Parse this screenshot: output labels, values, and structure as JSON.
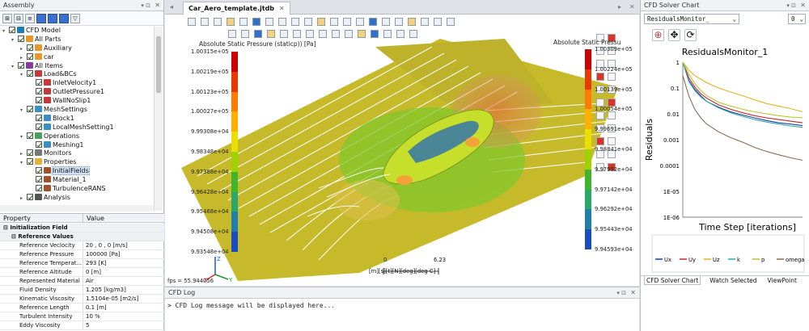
{
  "assembly": {
    "title": "Assembly",
    "tree": [
      {
        "label": "CFD Model",
        "depth": 0,
        "icon": "#1f7ab8",
        "open": true
      },
      {
        "label": "All Parts",
        "depth": 1,
        "icon": "#e8972a",
        "open": true
      },
      {
        "label": "Auxiliary",
        "depth": 2,
        "icon": "#e8972a",
        "open": false
      },
      {
        "label": "car",
        "depth": 2,
        "icon": "#e8972a",
        "open": false
      },
      {
        "label": "All Items",
        "depth": 1,
        "icon": "#8a3b99",
        "open": true
      },
      {
        "label": "Load&BCs",
        "depth": 2,
        "icon": "#c43a3a",
        "open": true
      },
      {
        "label": "InletVelocity1",
        "depth": 3,
        "icon": "#c43a3a"
      },
      {
        "label": "OutletPressure1",
        "depth": 3,
        "icon": "#c43a3a"
      },
      {
        "label": "WallNoSlip1",
        "depth": 3,
        "icon": "#c43a3a"
      },
      {
        "label": "MeshSettings",
        "depth": 2,
        "icon": "#3a8fc4",
        "open": true
      },
      {
        "label": "Block1",
        "depth": 3,
        "icon": "#3a8fc4"
      },
      {
        "label": "LocalMeshSetting1",
        "depth": 3,
        "icon": "#3a8fc4"
      },
      {
        "label": "Operations",
        "depth": 2,
        "icon": "#4aa05a",
        "open": true
      },
      {
        "label": "Meshing1",
        "depth": 3,
        "icon": "#3a8fc4"
      },
      {
        "label": "Monitors",
        "depth": 2,
        "icon": "#777777",
        "open": false
      },
      {
        "label": "Properties",
        "depth": 2,
        "icon": "#e0b23a",
        "open": true
      },
      {
        "label": "InitialFields",
        "depth": 3,
        "icon": "#a0522d",
        "selected": true
      },
      {
        "label": "Material_1",
        "depth": 3,
        "icon": "#a0522d"
      },
      {
        "label": "TurbulenceRANS",
        "depth": 3,
        "icon": "#a0522d"
      },
      {
        "label": "Analysis",
        "depth": 2,
        "icon": "#555555",
        "open": false
      }
    ]
  },
  "properties": {
    "col1": "Property",
    "col2": "Value",
    "group": "Initialization Field",
    "subgroup": "Reference Values",
    "rows": [
      {
        "k": "Reference Veclocity",
        "v": "20 , 0 , 0 [m/s]"
      },
      {
        "k": "Reference Pressure",
        "v": "100000 [Pa]"
      },
      {
        "k": "Reference Temperat...",
        "v": "293 [K]"
      },
      {
        "k": "Reference Altitude",
        "v": "0 [m]"
      },
      {
        "k": "Represented Material",
        "v": "Air"
      },
      {
        "k": "Fluid Density",
        "v": "1.205 [kg/m3]"
      },
      {
        "k": "Kinematic Viscosity",
        "v": "1.5104e-05 [m2/s]"
      },
      {
        "k": "Reference Length",
        "v": "0.1 [m]"
      },
      {
        "k": "Turbulent Intensity",
        "v": "10 %"
      },
      {
        "k": "Eddy Viscosity",
        "v": "5"
      }
    ]
  },
  "document": {
    "tab": "Car_Aero_template.jtdb",
    "legend_left": {
      "title": "Absolute Static Pressure (staticp)) [Pa]",
      "ticks": [
        "1.00315e+05",
        "1.00219e+05",
        "1.00123e+05",
        "1.00027e+05",
        "9.99308e+04",
        "9.98348e+04",
        "9.97388e+04",
        "9.96428e+04",
        "9.95468e+04",
        "9.94508e+04",
        "9.93548e+04"
      ]
    },
    "legend_right": {
      "title": "Absolute Static Pressu",
      "ticks": [
        "1.00309e+05",
        "1.00224e+05",
        "1.00139e+05",
        "1.00054e+05",
        "9.99691e+04",
        "9.98841e+04",
        "9.97992e+04",
        "9.97142e+04",
        "9.96292e+04",
        "9.95443e+04",
        "9.94593e+04"
      ]
    },
    "fps": "fps = 55.944056",
    "scale": {
      "zero": "0",
      "max": "6.23",
      "units": "[m][s][t][N][deg][deg C]"
    },
    "axes": {
      "x": "X",
      "y": "Y",
      "z": "Z"
    },
    "colormap": [
      "#cc0000",
      "#e63a00",
      "#ff7a00",
      "#ffb000",
      "#e8e000",
      "#9fd300",
      "#3fb52b",
      "#2aa86a",
      "#1e7fa8",
      "#1a4cc0"
    ]
  },
  "log": {
    "title": "CFD Log",
    "message": "> CFD Log message will be displayed here..."
  },
  "chart_panel": {
    "title": "CFD Solver Chart",
    "monitor": "ResidualsMonitor_",
    "index": "0",
    "tabs": [
      "CFD Solver Chart",
      "Watch Selected",
      "ViewPoint"
    ]
  },
  "chart_data": {
    "type": "line",
    "title": "ResidualsMonitor_1",
    "xlabel": "Time Step [iterations]",
    "ylabel": "Residuals",
    "yscale": "log",
    "y_ticks": [
      "1",
      "0.1",
      "0.01",
      "0.001",
      "0.0001",
      "1E-05",
      "1E-06"
    ],
    "ylim": [
      1e-06,
      1
    ],
    "x": [
      0,
      0.05,
      0.1,
      0.15,
      0.2,
      0.3,
      0.4,
      0.5,
      0.6,
      0.7,
      0.8,
      0.9,
      1.0
    ],
    "series": [
      {
        "name": "Ux",
        "color": "#1f3f9a",
        "values": [
          1,
          0.2,
          0.09,
          0.05,
          0.03,
          0.018,
          0.012,
          0.009,
          0.007,
          0.0055,
          0.0045,
          0.004,
          0.0035
        ]
      },
      {
        "name": "Uy",
        "color": "#c8242f",
        "values": [
          1,
          0.25,
          0.11,
          0.06,
          0.04,
          0.022,
          0.015,
          0.011,
          0.0085,
          0.007,
          0.006,
          0.0052,
          0.0045
        ]
      },
      {
        "name": "Uz",
        "color": "#e3b31f",
        "values": [
          1,
          0.5,
          0.3,
          0.22,
          0.16,
          0.1,
          0.07,
          0.05,
          0.035,
          0.025,
          0.02,
          0.016,
          0.012
        ]
      },
      {
        "name": "k",
        "color": "#2aa8a8",
        "values": [
          1,
          0.18,
          0.08,
          0.045,
          0.03,
          0.017,
          0.011,
          0.008,
          0.006,
          0.0048,
          0.004,
          0.0034,
          0.003
        ]
      },
      {
        "name": "p",
        "color": "#b8c42a",
        "values": [
          1,
          0.35,
          0.15,
          0.08,
          0.05,
          0.028,
          0.02,
          0.015,
          0.012,
          0.01,
          0.0085,
          0.0075,
          0.007
        ]
      },
      {
        "name": "omega",
        "color": "#8a6a50",
        "values": [
          0.3,
          0.05,
          0.015,
          0.007,
          0.004,
          0.002,
          0.0012,
          0.0008,
          0.0005,
          0.00035,
          0.00026,
          0.0002,
          0.00016
        ]
      }
    ]
  }
}
